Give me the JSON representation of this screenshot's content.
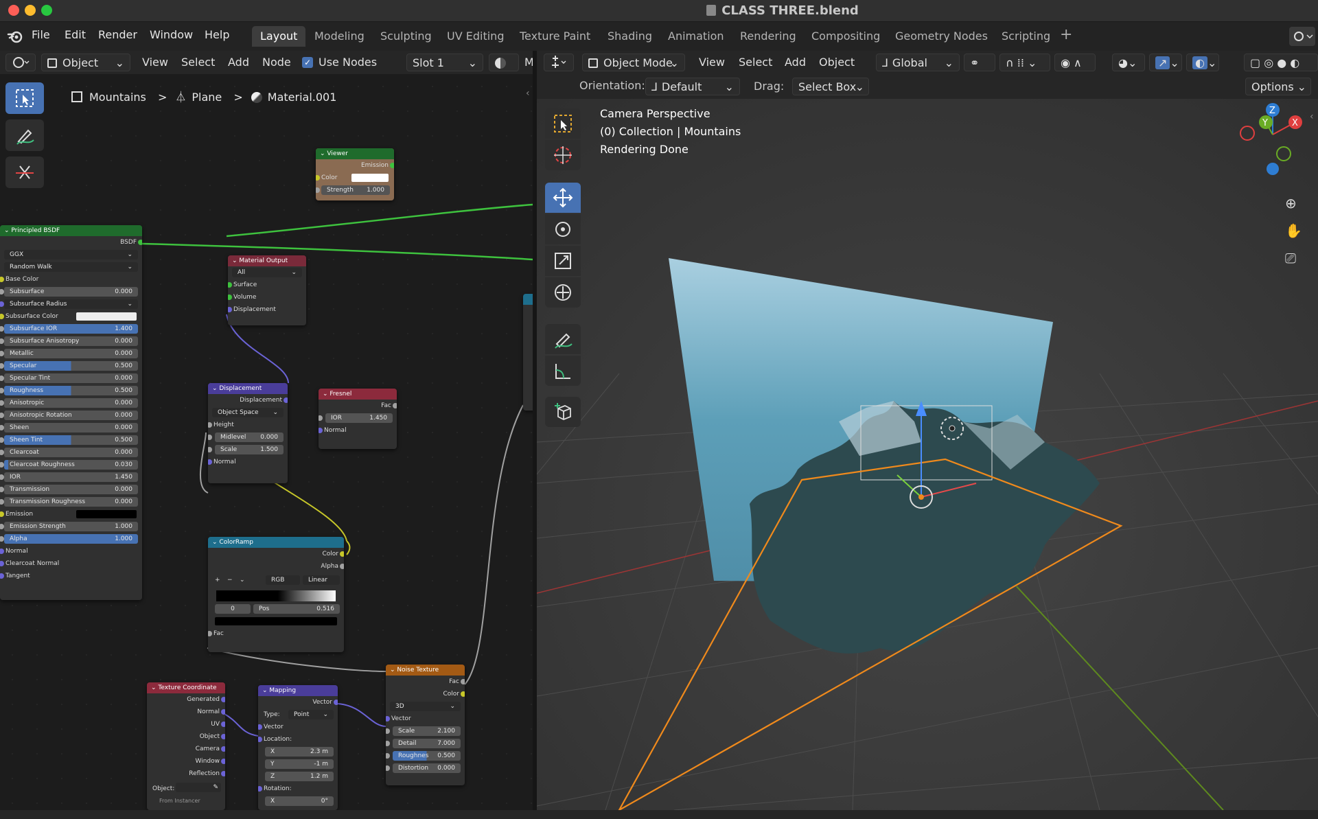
{
  "window": {
    "title": "CLASS THREE.blend"
  },
  "menu": {
    "items": [
      "File",
      "Edit",
      "Render",
      "Window",
      "Help"
    ]
  },
  "workspaces": [
    {
      "label": "Layout",
      "active": true
    },
    {
      "label": "Modeling"
    },
    {
      "label": "Sculpting"
    },
    {
      "label": "UV Editing"
    },
    {
      "label": "Texture Paint"
    },
    {
      "label": "Shading"
    },
    {
      "label": "Animation"
    },
    {
      "label": "Rendering"
    },
    {
      "label": "Compositing"
    },
    {
      "label": "Geometry Nodes"
    },
    {
      "label": "Scripting"
    }
  ],
  "node_editor": {
    "header": {
      "object": "Object",
      "view": "View",
      "select": "Select",
      "add": "Add",
      "node": "Node",
      "use_nodes": "Use Nodes",
      "slot": "Slot 1",
      "m": "M"
    },
    "breadcrumb": {
      "scene": "Mountains",
      "object": "Plane",
      "material": "Material.001"
    },
    "nodes": {
      "viewer": {
        "title": "Viewer",
        "emission": "Emission",
        "color": "Color",
        "strength_label": "Strength",
        "strength": "1.000"
      },
      "principled": {
        "title": "Principled BSDF",
        "bsdf": "BSDF",
        "distribution": "GGX",
        "subsurface_method": "Random Walk",
        "rows": [
          {
            "label": "Base Color",
            "type": "plain"
          },
          {
            "label": "Subsurface",
            "value": "0.000",
            "fill": 0
          },
          {
            "label": "Subsurface Radius",
            "type": "dropdown"
          },
          {
            "label": "Subsurface Color",
            "type": "color",
            "color": "#eeeeee"
          },
          {
            "label": "Subsurface IOR",
            "value": "1.400",
            "fill": 1
          },
          {
            "label": "Subsurface Anisotropy",
            "value": "0.000",
            "fill": 0
          },
          {
            "label": "Metallic",
            "value": "0.000",
            "fill": 0
          },
          {
            "label": "Specular",
            "value": "0.500",
            "fill": 0.5
          },
          {
            "label": "Specular Tint",
            "value": "0.000",
            "fill": 0
          },
          {
            "label": "Roughness",
            "value": "0.500",
            "fill": 0.5
          },
          {
            "label": "Anisotropic",
            "value": "0.000",
            "fill": 0
          },
          {
            "label": "Anisotropic Rotation",
            "value": "0.000",
            "fill": 0
          },
          {
            "label": "Sheen",
            "value": "0.000",
            "fill": 0
          },
          {
            "label": "Sheen Tint",
            "value": "0.500",
            "fill": 0.5
          },
          {
            "label": "Clearcoat",
            "value": "0.000",
            "fill": 0
          },
          {
            "label": "Clearcoat Roughness",
            "value": "0.030",
            "fill": 0.03
          },
          {
            "label": "IOR",
            "value": "1.450",
            "fill": 0
          },
          {
            "label": "Transmission",
            "value": "0.000",
            "fill": 0
          },
          {
            "label": "Transmission Roughness",
            "value": "0.000",
            "fill": 0
          },
          {
            "label": "Emission",
            "type": "color",
            "color": "#000000"
          },
          {
            "label": "Emission Strength",
            "value": "1.000",
            "fill": 0
          },
          {
            "label": "Alpha",
            "value": "1.000",
            "fill": 1
          },
          {
            "label": "Normal",
            "type": "plain"
          },
          {
            "label": "Clearcoat Normal",
            "type": "plain"
          },
          {
            "label": "Tangent",
            "type": "plain"
          }
        ]
      },
      "material_output": {
        "title": "Material Output",
        "target": "All",
        "surface": "Surface",
        "volume": "Volume",
        "displacement": "Displacement"
      },
      "displacement": {
        "title": "Displacement",
        "out": "Displacement",
        "space": "Object Space",
        "height": "Height",
        "midlevel_label": "Midlevel",
        "midlevel": "0.000",
        "scale_label": "Scale",
        "scale": "1.500",
        "normal": "Normal"
      },
      "fresnel": {
        "title": "Fresnel",
        "fac": "Fac",
        "ior_label": "IOR",
        "ior": "1.450",
        "normal": "Normal"
      },
      "colorramp": {
        "title": "ColorRamp",
        "color": "Color",
        "alpha": "Alpha",
        "mode": "RGB",
        "interp": "Linear",
        "index": "0",
        "pos_label": "Pos",
        "pos": "0.516",
        "fac": "Fac"
      },
      "noise": {
        "title": "Noise Texture",
        "fac": "Fac",
        "color": "Color",
        "dim": "3D",
        "vector": "Vector",
        "scale_label": "Scale",
        "scale": "2.100",
        "detail_label": "Detail",
        "detail": "7.000",
        "rough_label": "Roughnes",
        "rough": "0.500",
        "dist_label": "Distortion",
        "dist": "0.000"
      },
      "texcoord": {
        "title": "Texture Coordinate",
        "outputs": [
          "Generated",
          "Normal",
          "UV",
          "Object",
          "Camera",
          "Window",
          "Reflection"
        ],
        "object": "Object:",
        "from_instancer": "From Instancer"
      },
      "mapping": {
        "title": "Mapping",
        "vector_out": "Vector",
        "type_label": "Type:",
        "type": "Point",
        "vector_in": "Vector",
        "location": "Location:",
        "x": "2.3 m",
        "y": "-1 m",
        "z": "1.2 m",
        "rotation": "Rotation:",
        "rx": "0°"
      }
    }
  },
  "viewport": {
    "header": {
      "mode": "Object Mode",
      "view": "View",
      "select": "Select",
      "add": "Add",
      "object": "Object",
      "orientation": "Global"
    },
    "sub": {
      "orientation_label": "Orientation:",
      "orientation_value": "Default",
      "drag_label": "Drag:",
      "drag_value": "Select Box",
      "options": "Options"
    },
    "overlay": [
      "Camera Perspective",
      "(0) Collection | Mountains",
      "Rendering Done"
    ],
    "gizmo": {
      "z": "Z",
      "y": "Y",
      "x": "X"
    }
  },
  "colors": {
    "accent": "#4772b3",
    "shader_header": "#1f6b2c",
    "output_header": "#7a2a3a",
    "vector_header": "#4a3d9a",
    "converter_header": "#1e6e8c",
    "texture_header": "#a35a14",
    "input_header": "#8c2a3c",
    "camera_frame": "#f08a1c"
  }
}
